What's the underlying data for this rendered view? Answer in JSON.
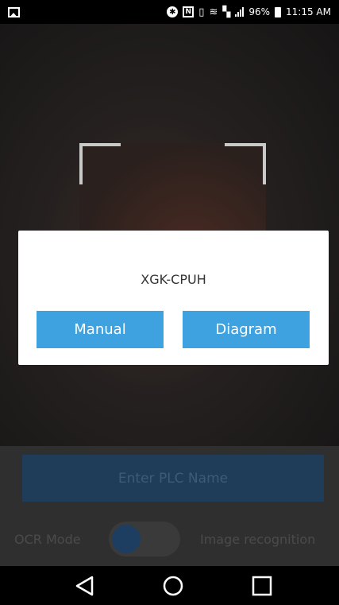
{
  "status_bar": {
    "battery": "96%",
    "time": "11:15 AM",
    "icons": [
      "gallery-icon",
      "bluetooth-icon",
      "nfc-icon",
      "vibrate-icon",
      "wifi-icon",
      "no-sim-icon",
      "signal-icon",
      "battery-icon"
    ]
  },
  "dialog": {
    "title": "XGK-CPUH",
    "manual_label": "Manual",
    "diagram_label": "Diagram",
    "button_color": "#3ea2e0"
  },
  "controls": {
    "plc_input_placeholder": "Enter PLC Name",
    "ocr_label": "OCR Mode",
    "image_label": "Image recognition"
  },
  "nav": {
    "icons": [
      "back-icon",
      "home-icon",
      "recent-apps-icon"
    ]
  }
}
